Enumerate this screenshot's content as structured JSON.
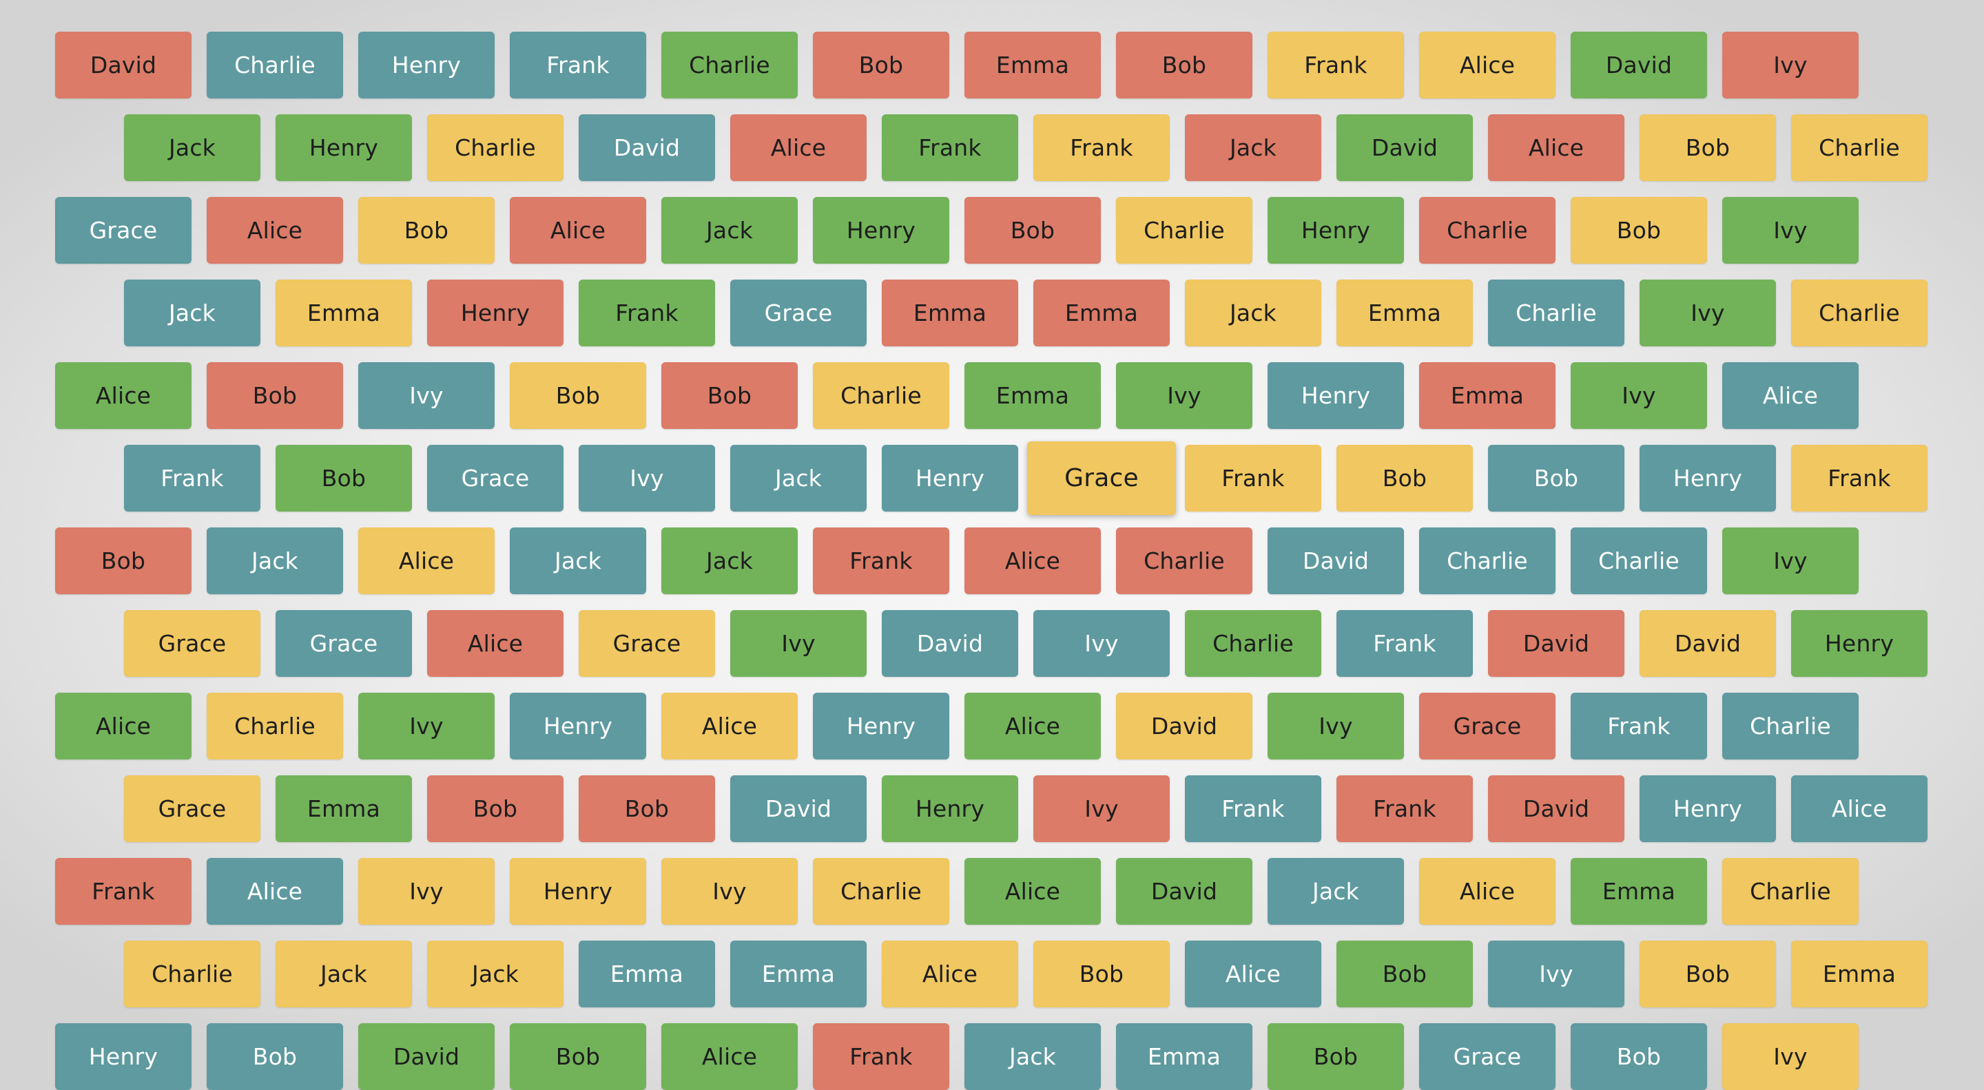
{
  "colors": {
    "red": "#db7b68",
    "teal": "#5e9aa0",
    "green": "#72b35a",
    "yellow": "#f0c760"
  },
  "hovered_tile": {
    "row": 5,
    "col": 6
  },
  "rows": [
    [
      {
        "label": "David",
        "color": "red"
      },
      {
        "label": "Charlie",
        "color": "teal"
      },
      {
        "label": "Henry",
        "color": "teal"
      },
      {
        "label": "Frank",
        "color": "teal"
      },
      {
        "label": "Charlie",
        "color": "green"
      },
      {
        "label": "Bob",
        "color": "red"
      },
      {
        "label": "Emma",
        "color": "red"
      },
      {
        "label": "Bob",
        "color": "red"
      },
      {
        "label": "Frank",
        "color": "yellow"
      },
      {
        "label": "Alice",
        "color": "yellow"
      },
      {
        "label": "David",
        "color": "green"
      },
      {
        "label": "Ivy",
        "color": "red"
      }
    ],
    [
      {
        "label": "Jack",
        "color": "green"
      },
      {
        "label": "Henry",
        "color": "green"
      },
      {
        "label": "Charlie",
        "color": "yellow"
      },
      {
        "label": "David",
        "color": "teal"
      },
      {
        "label": "Alice",
        "color": "red"
      },
      {
        "label": "Frank",
        "color": "green"
      },
      {
        "label": "Frank",
        "color": "yellow"
      },
      {
        "label": "Jack",
        "color": "red"
      },
      {
        "label": "David",
        "color": "green"
      },
      {
        "label": "Alice",
        "color": "red"
      },
      {
        "label": "Bob",
        "color": "yellow"
      },
      {
        "label": "Charlie",
        "color": "yellow"
      }
    ],
    [
      {
        "label": "Grace",
        "color": "teal"
      },
      {
        "label": "Alice",
        "color": "red"
      },
      {
        "label": "Bob",
        "color": "yellow"
      },
      {
        "label": "Alice",
        "color": "red"
      },
      {
        "label": "Jack",
        "color": "green"
      },
      {
        "label": "Henry",
        "color": "green"
      },
      {
        "label": "Bob",
        "color": "red"
      },
      {
        "label": "Charlie",
        "color": "yellow"
      },
      {
        "label": "Henry",
        "color": "green"
      },
      {
        "label": "Charlie",
        "color": "red"
      },
      {
        "label": "Bob",
        "color": "yellow"
      },
      {
        "label": "Ivy",
        "color": "green"
      }
    ],
    [
      {
        "label": "Jack",
        "color": "teal"
      },
      {
        "label": "Emma",
        "color": "yellow"
      },
      {
        "label": "Henry",
        "color": "red"
      },
      {
        "label": "Frank",
        "color": "green"
      },
      {
        "label": "Grace",
        "color": "teal"
      },
      {
        "label": "Emma",
        "color": "red"
      },
      {
        "label": "Emma",
        "color": "red"
      },
      {
        "label": "Jack",
        "color": "yellow"
      },
      {
        "label": "Emma",
        "color": "yellow"
      },
      {
        "label": "Charlie",
        "color": "teal"
      },
      {
        "label": "Ivy",
        "color": "green"
      },
      {
        "label": "Charlie",
        "color": "yellow"
      }
    ],
    [
      {
        "label": "Alice",
        "color": "green"
      },
      {
        "label": "Bob",
        "color": "red"
      },
      {
        "label": "Ivy",
        "color": "teal"
      },
      {
        "label": "Bob",
        "color": "yellow"
      },
      {
        "label": "Bob",
        "color": "red"
      },
      {
        "label": "Charlie",
        "color": "yellow"
      },
      {
        "label": "Emma",
        "color": "green"
      },
      {
        "label": "Ivy",
        "color": "green"
      },
      {
        "label": "Henry",
        "color": "teal"
      },
      {
        "label": "Emma",
        "color": "red"
      },
      {
        "label": "Ivy",
        "color": "green"
      },
      {
        "label": "Alice",
        "color": "teal"
      }
    ],
    [
      {
        "label": "Frank",
        "color": "teal"
      },
      {
        "label": "Bob",
        "color": "green"
      },
      {
        "label": "Grace",
        "color": "teal"
      },
      {
        "label": "Ivy",
        "color": "teal"
      },
      {
        "label": "Jack",
        "color": "teal"
      },
      {
        "label": "Henry",
        "color": "teal"
      },
      {
        "label": "Grace",
        "color": "yellow"
      },
      {
        "label": "Frank",
        "color": "yellow"
      },
      {
        "label": "Bob",
        "color": "yellow"
      },
      {
        "label": "Bob",
        "color": "teal"
      },
      {
        "label": "Henry",
        "color": "teal"
      },
      {
        "label": "Frank",
        "color": "yellow"
      }
    ],
    [
      {
        "label": "Bob",
        "color": "red"
      },
      {
        "label": "Jack",
        "color": "teal"
      },
      {
        "label": "Alice",
        "color": "yellow"
      },
      {
        "label": "Jack",
        "color": "teal"
      },
      {
        "label": "Jack",
        "color": "green"
      },
      {
        "label": "Frank",
        "color": "red"
      },
      {
        "label": "Alice",
        "color": "red"
      },
      {
        "label": "Charlie",
        "color": "red"
      },
      {
        "label": "David",
        "color": "teal"
      },
      {
        "label": "Charlie",
        "color": "teal"
      },
      {
        "label": "Charlie",
        "color": "teal"
      },
      {
        "label": "Ivy",
        "color": "green"
      }
    ],
    [
      {
        "label": "Grace",
        "color": "yellow"
      },
      {
        "label": "Grace",
        "color": "teal"
      },
      {
        "label": "Alice",
        "color": "red"
      },
      {
        "label": "Grace",
        "color": "yellow"
      },
      {
        "label": "Ivy",
        "color": "green"
      },
      {
        "label": "David",
        "color": "teal"
      },
      {
        "label": "Ivy",
        "color": "teal"
      },
      {
        "label": "Charlie",
        "color": "green"
      },
      {
        "label": "Frank",
        "color": "teal"
      },
      {
        "label": "David",
        "color": "red"
      },
      {
        "label": "David",
        "color": "yellow"
      },
      {
        "label": "Henry",
        "color": "green"
      }
    ],
    [
      {
        "label": "Alice",
        "color": "green"
      },
      {
        "label": "Charlie",
        "color": "yellow"
      },
      {
        "label": "Ivy",
        "color": "green"
      },
      {
        "label": "Henry",
        "color": "teal"
      },
      {
        "label": "Alice",
        "color": "yellow"
      },
      {
        "label": "Henry",
        "color": "teal"
      },
      {
        "label": "Alice",
        "color": "green"
      },
      {
        "label": "David",
        "color": "yellow"
      },
      {
        "label": "Ivy",
        "color": "green"
      },
      {
        "label": "Grace",
        "color": "red"
      },
      {
        "label": "Frank",
        "color": "teal"
      },
      {
        "label": "Charlie",
        "color": "teal"
      }
    ],
    [
      {
        "label": "Grace",
        "color": "yellow"
      },
      {
        "label": "Emma",
        "color": "green"
      },
      {
        "label": "Bob",
        "color": "red"
      },
      {
        "label": "Bob",
        "color": "red"
      },
      {
        "label": "David",
        "color": "teal"
      },
      {
        "label": "Henry",
        "color": "green"
      },
      {
        "label": "Ivy",
        "color": "red"
      },
      {
        "label": "Frank",
        "color": "teal"
      },
      {
        "label": "Frank",
        "color": "red"
      },
      {
        "label": "David",
        "color": "red"
      },
      {
        "label": "Henry",
        "color": "teal"
      },
      {
        "label": "Alice",
        "color": "teal"
      }
    ],
    [
      {
        "label": "Frank",
        "color": "red"
      },
      {
        "label": "Alice",
        "color": "teal"
      },
      {
        "label": "Ivy",
        "color": "yellow"
      },
      {
        "label": "Henry",
        "color": "yellow"
      },
      {
        "label": "Ivy",
        "color": "yellow"
      },
      {
        "label": "Charlie",
        "color": "yellow"
      },
      {
        "label": "Alice",
        "color": "green"
      },
      {
        "label": "David",
        "color": "green"
      },
      {
        "label": "Jack",
        "color": "teal"
      },
      {
        "label": "Alice",
        "color": "yellow"
      },
      {
        "label": "Emma",
        "color": "green"
      },
      {
        "label": "Charlie",
        "color": "yellow"
      }
    ],
    [
      {
        "label": "Charlie",
        "color": "yellow"
      },
      {
        "label": "Jack",
        "color": "yellow"
      },
      {
        "label": "Jack",
        "color": "yellow"
      },
      {
        "label": "Emma",
        "color": "teal"
      },
      {
        "label": "Emma",
        "color": "teal"
      },
      {
        "label": "Alice",
        "color": "yellow"
      },
      {
        "label": "Bob",
        "color": "yellow"
      },
      {
        "label": "Alice",
        "color": "teal"
      },
      {
        "label": "Bob",
        "color": "green"
      },
      {
        "label": "Ivy",
        "color": "teal"
      },
      {
        "label": "Bob",
        "color": "yellow"
      },
      {
        "label": "Emma",
        "color": "yellow"
      }
    ],
    [
      {
        "label": "Henry",
        "color": "teal"
      },
      {
        "label": "Bob",
        "color": "teal"
      },
      {
        "label": "David",
        "color": "green"
      },
      {
        "label": "Bob",
        "color": "green"
      },
      {
        "label": "Alice",
        "color": "green"
      },
      {
        "label": "Frank",
        "color": "red"
      },
      {
        "label": "Jack",
        "color": "teal"
      },
      {
        "label": "Emma",
        "color": "teal"
      },
      {
        "label": "Bob",
        "color": "green"
      },
      {
        "label": "Grace",
        "color": "teal"
      },
      {
        "label": "Bob",
        "color": "teal"
      },
      {
        "label": "Ivy",
        "color": "yellow"
      }
    ]
  ]
}
